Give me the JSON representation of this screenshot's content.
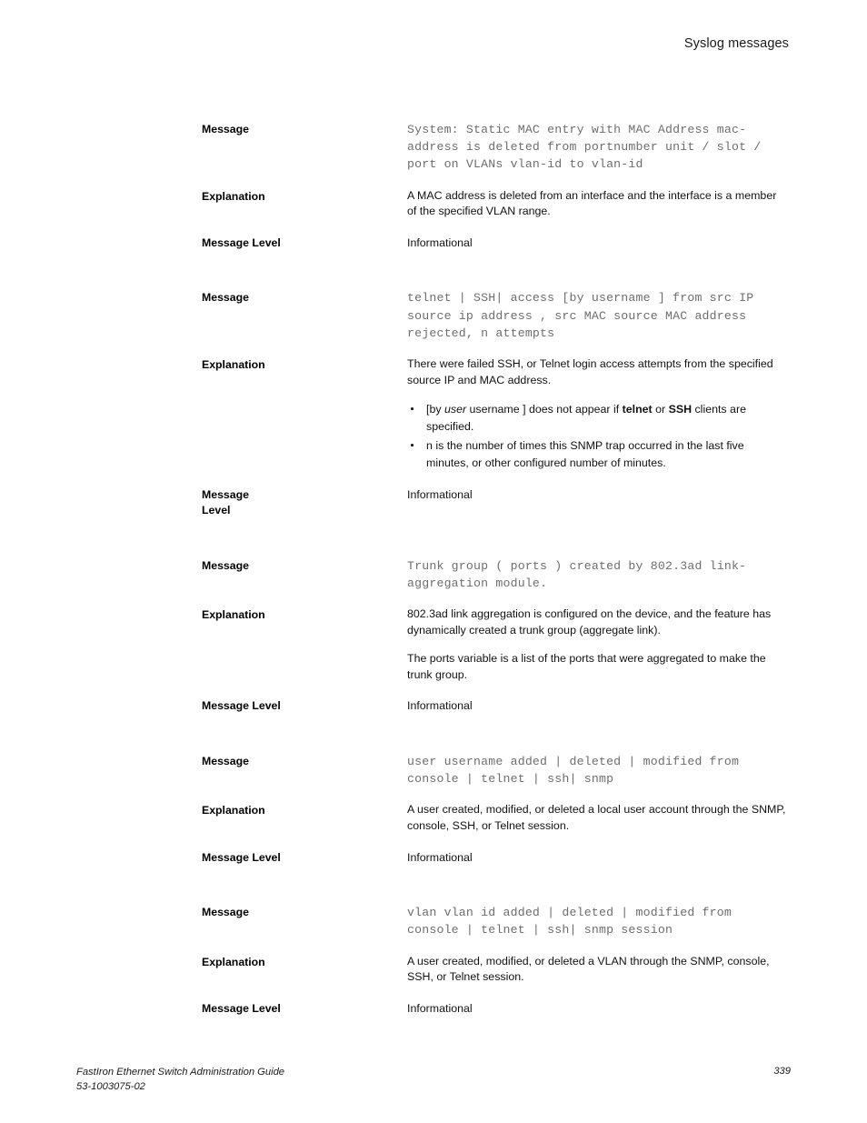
{
  "header": {
    "running_head": "Syslog messages"
  },
  "labels": {
    "message": "Message",
    "explanation": "Explanation",
    "message_level": "Message Level",
    "message_level_wrapped": "Message\nLevel"
  },
  "blocks": [
    {
      "message_label": "Message",
      "message_text": "System: Static MAC entry with MAC Address mac-address is deleted from portnumber unit / slot / port on VLANs vlan-id to vlan-id",
      "explanation_label": "Explanation",
      "explanation_paragraphs": [
        "A MAC address is deleted from an interface and the interface is a member of the specified VLAN range."
      ],
      "bullets": [],
      "level_label": "Message Level",
      "level_value": "Informational"
    },
    {
      "message_label": "Message",
      "message_text": "telnet | SSH| access [by username ] from src IP source ip address , src MAC source MAC address rejected, n attempts",
      "explanation_label": "Explanation",
      "explanation_paragraphs": [
        "There were failed SSH, or Telnet login access attempts from the specified source IP and MAC address."
      ],
      "bullets": [
        {
          "prefix": "[by ",
          "italic": "user",
          "mid1": " username ] does not appear if ",
          "bold1": "telnet",
          "mid2": " or ",
          "bold2": "SSH",
          "suffix": " clients are specified."
        },
        {
          "plain": "n is the number of times this SNMP trap occurred in the last five minutes, or other configured number of minutes."
        }
      ],
      "level_label": "Message\nLevel",
      "level_value": "Informational"
    },
    {
      "message_label": "Message",
      "message_text": "Trunk group ( ports ) created by 802.3ad link-aggregation module.",
      "explanation_label": "Explanation",
      "explanation_paragraphs": [
        "802.3ad link aggregation is configured on the device, and the feature has dynamically created a trunk group (aggregate link).",
        "The ports variable is a list of the ports that were aggregated to make the trunk group."
      ],
      "bullets": [],
      "level_label": "Message Level",
      "level_value": "Informational"
    },
    {
      "message_label": "Message",
      "message_text": "user username added | deleted | modified from console | telnet | ssh| snmp",
      "explanation_label": "Explanation",
      "explanation_paragraphs": [
        "A user created, modified, or deleted a local user account through the SNMP, console, SSH, or Telnet session."
      ],
      "bullets": [],
      "level_label": "Message Level",
      "level_value": "Informational"
    },
    {
      "message_label": "Message",
      "message_text": "vlan vlan id added | deleted | modified from console | telnet | ssh| snmp session",
      "explanation_label": "Explanation",
      "explanation_paragraphs": [
        "A user created, modified, or deleted a VLAN through the SNMP, console, SSH, or Telnet session."
      ],
      "bullets": [],
      "level_label": "Message Level",
      "level_value": "Informational"
    }
  ],
  "footer": {
    "guide_title": "FastIron Ethernet Switch Administration Guide",
    "document_number": "53-1003075-02",
    "page_number": "339"
  }
}
